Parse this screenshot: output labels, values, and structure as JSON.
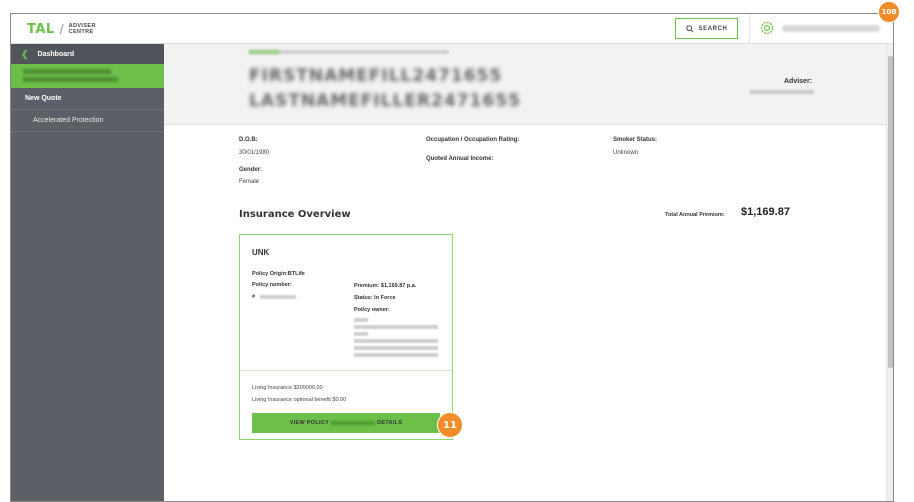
{
  "header": {
    "logo_main": "TAL",
    "logo_slash": "/",
    "logo_sub_1": "ADVISER",
    "logo_sub_2": "CENTRE",
    "search_label": "SEARCH"
  },
  "sidebar": {
    "dashboard_label": "Dashboard",
    "items": [
      {
        "label": "New Quote"
      },
      {
        "label": "Accelerated Protection"
      }
    ]
  },
  "client": {
    "first_name": "FIRSTNAMEFILL2471655",
    "last_name": "LASTNAMEFILLER2471655",
    "adviser_label": "Adviser:"
  },
  "details": {
    "dob_label": "D.O.B:",
    "dob_value": "30/01/1980",
    "gender_label": "Gender:",
    "gender_value": "Female",
    "occupation_label": "Occupation / Occupation Rating:",
    "quoted_income_label": "Quoted Annual Income:",
    "smoker_label": "Smoker Status:",
    "smoker_value": "Unknown"
  },
  "overview": {
    "title": "Insurance Overview",
    "total_label": "Total Annual Premium:",
    "total_value": "$1,169.87"
  },
  "policy": {
    "code": "UNK",
    "origin": "Policy Origin:BTLife",
    "number_label": "Policy number:",
    "number_prefix": "#",
    "premium": "Premium: $1,169.87 p.a.",
    "status": "Status: In Force",
    "owner_label": "Policy owner:",
    "benefit_1": "Living Insurance $309000.00",
    "benefit_2": "Living Insurance optional benefit $0.00",
    "view_prefix": "VIEW POLICY",
    "view_suffix": "DETAILS"
  },
  "badges": {
    "step_a": "10B",
    "step_b": "11"
  },
  "colors": {
    "brand_green": "#6cc04a",
    "sidebar_bg": "#5a6066",
    "badge_orange": "#f28c28"
  }
}
